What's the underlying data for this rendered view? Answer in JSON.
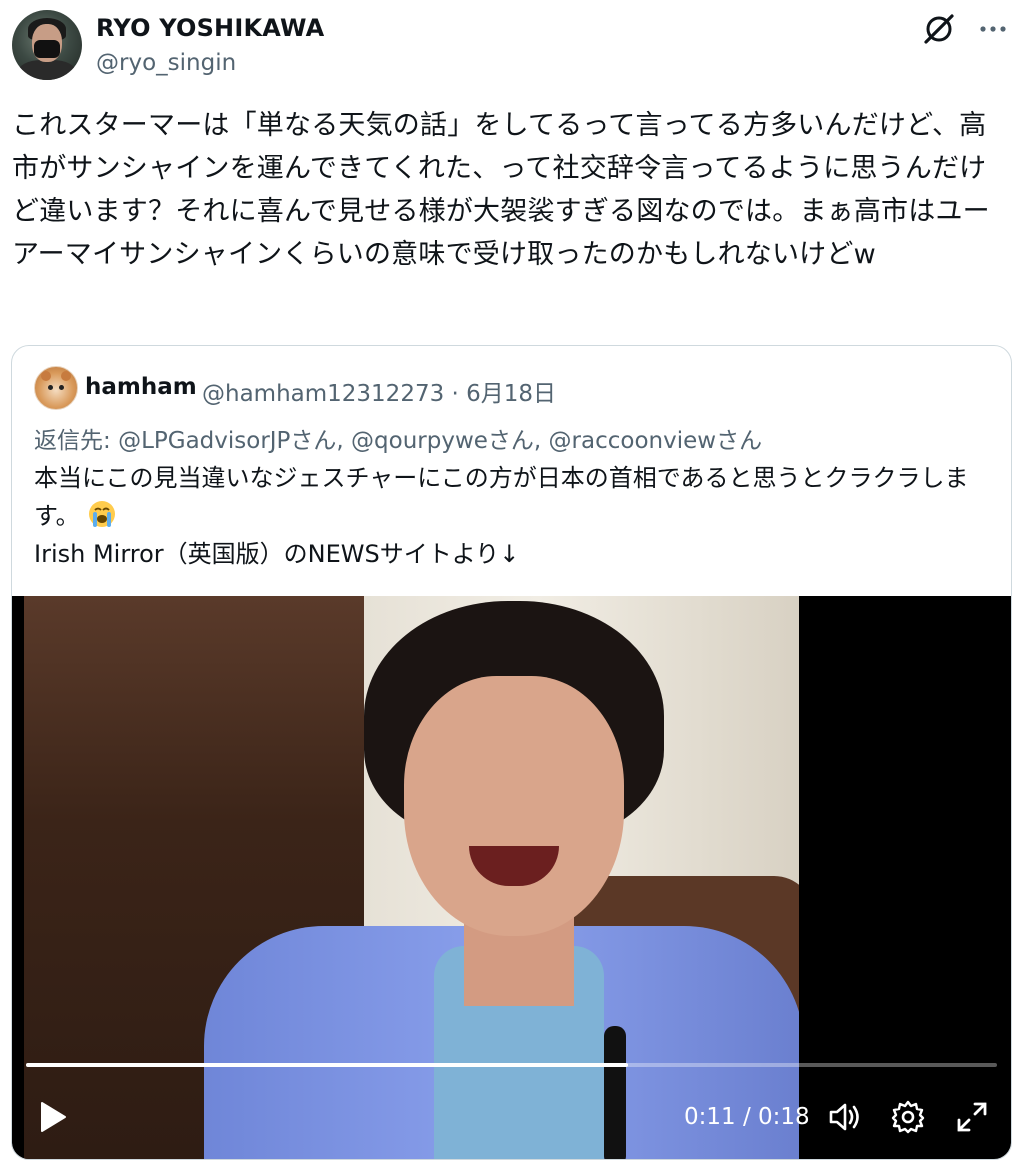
{
  "author": {
    "name": "RYO YOSHIKAWA",
    "handle": "@ryo_singin"
  },
  "icons": {
    "grok": "grok-icon",
    "more": "more-icon"
  },
  "tweet": {
    "text": "これスターマーは「単なる天気の話」をしてるって言ってる方多いんだけど、高市がサンシャインを運んできてくれた、って社交辞令言ってるように思うんだけど違います？それに喜んで見せる様が大袈裟すぎる図なのでは。まぁ高市はユーアーマイサンシャインくらいの意味で受け取ったのかもしれないけどw"
  },
  "quote": {
    "name": "hamham",
    "meta": "@hamham12312273 · 6月18日",
    "reply_prefix": "返信先: ",
    "reply_mentions": "@LPGadvisorJPさん, @qourpyweさん, @raccoonviewさん",
    "body_line1": "本当にこの見当違いなジェスチャーにこの方が日本の首相であると思うとクラクラします。",
    "body_line2": "Irish Mirror（英国版）のNEWSサイトより↓",
    "emoji": "loudly-crying-face"
  },
  "video": {
    "current_time": "0:11",
    "duration": "0:18",
    "time_text": "0:11 / 0:18",
    "progress": 0.62
  },
  "colors": {
    "text": "#0f1419",
    "secondary": "#536471",
    "border": "#cfd9de"
  }
}
